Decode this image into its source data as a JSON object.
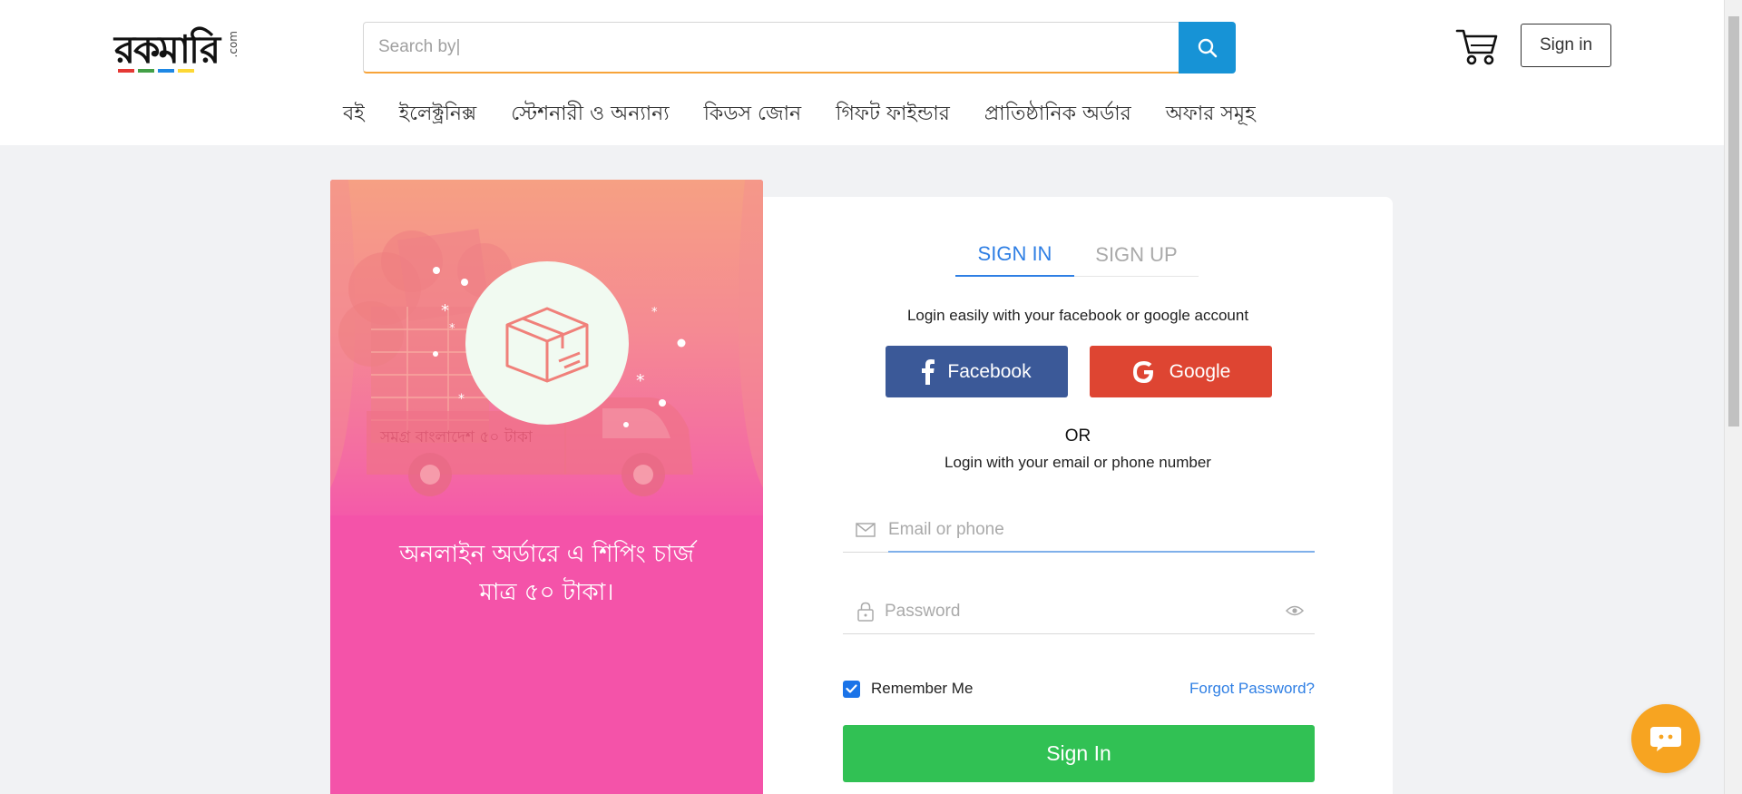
{
  "header": {
    "logo_text": "রকমারি",
    "logo_suffix": ".com",
    "search_placeholder": "Search by|",
    "signin_label": "Sign in",
    "nav": [
      "বই",
      "ইলেক্ট্রনিক্স",
      "স্টেশনারী ও অন্যান্য",
      "কিডস জোন",
      "গিফট ফাইন্ডার",
      "প্রাতিষ্ঠানিক অর্ডার",
      "অফার সমূহ"
    ]
  },
  "promo": {
    "truck_text": "সমগ্র বাংলাদেশ ৫০ টাকা",
    "line1": "অনলাইন অর্ডারে এ শিপিং চার্জ",
    "line2": "মাত্র ৫০ টাকা।"
  },
  "login": {
    "tab_signin": "SIGN IN",
    "tab_signup": "SIGN UP",
    "social_hint": "Login easily with your facebook or google account",
    "facebook_label": "Facebook",
    "google_label": "Google",
    "or_label": "OR",
    "email_hint": "Login with your email or phone number",
    "email_placeholder": "Email or phone",
    "password_placeholder": "Password",
    "remember_label": "Remember Me",
    "forgot_label": "Forgot Password?",
    "submit_label": "Sign In"
  },
  "colors": {
    "search_accent": "#1793d6",
    "tab_active": "#2f7fe4",
    "facebook": "#3b5998",
    "google": "#de4532",
    "submit": "#31c154",
    "promo_bg": "#f453a9",
    "chat": "#f7a421"
  },
  "icons": {
    "search": "search-icon",
    "cart": "cart-icon",
    "email": "envelope-icon",
    "password": "lock-icon",
    "show_password": "eye-icon",
    "chat": "chat-icon"
  }
}
